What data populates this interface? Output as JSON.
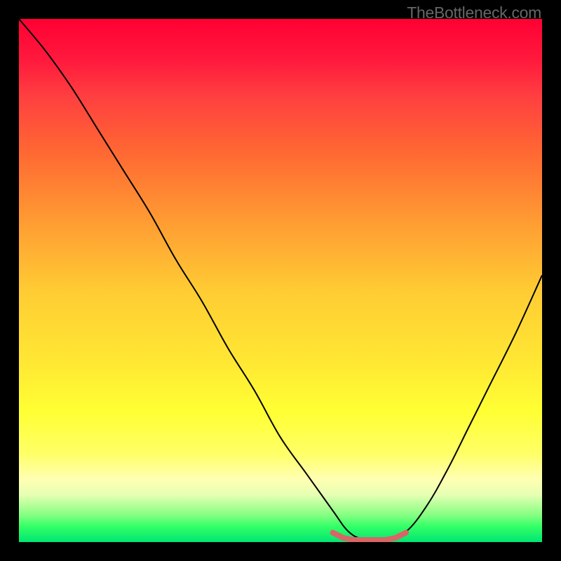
{
  "attribution": "TheBottleneck.com",
  "chart_data": {
    "type": "line",
    "title": "",
    "xlabel": "",
    "ylabel": "",
    "xlim": [
      0,
      100
    ],
    "ylim": [
      0,
      100
    ],
    "series": [
      {
        "name": "bottleneck-curve",
        "x": [
          0,
          5,
          10,
          15,
          20,
          25,
          30,
          35,
          40,
          45,
          50,
          55,
          60,
          63,
          66,
          70,
          74,
          78,
          82,
          86,
          90,
          95,
          100
        ],
        "y": [
          100,
          94,
          87,
          79,
          71,
          63,
          54,
          46,
          37,
          29,
          20,
          13,
          6,
          2,
          0.5,
          0.5,
          2,
          7,
          14,
          22,
          30,
          40,
          51
        ]
      },
      {
        "name": "optimal-marker",
        "x": [
          60,
          62,
          64,
          66,
          68,
          70,
          72,
          74
        ],
        "y": [
          1.8,
          0.8,
          0.4,
          0.4,
          0.4,
          0.4,
          0.8,
          1.8
        ]
      }
    ],
    "background_gradient": {
      "top_color": "#ff0033",
      "mid_color": "#ffff33",
      "bottom_color": "#00e673"
    }
  }
}
